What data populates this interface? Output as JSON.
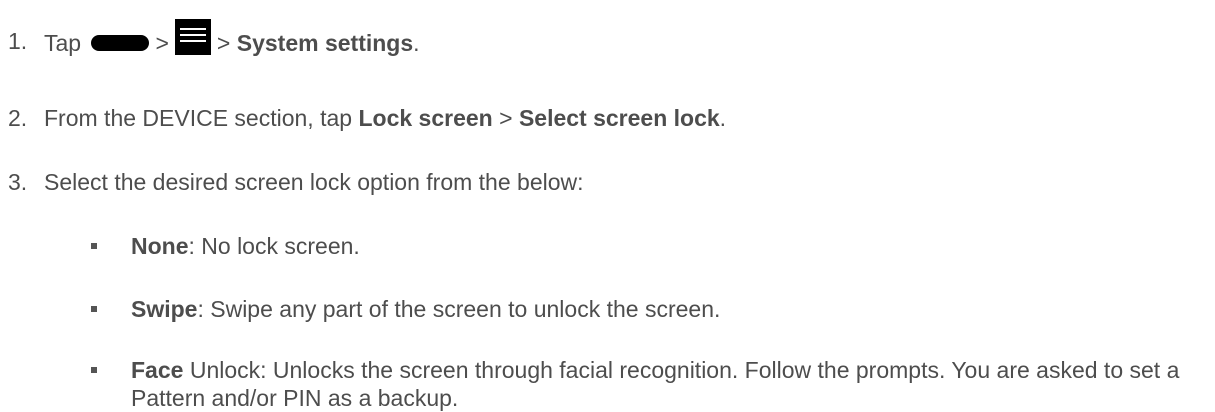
{
  "steps": [
    {
      "num": "1.",
      "tap": "Tap",
      "sep1": ">",
      "sep2": ">",
      "target": "System settings",
      "end": ".",
      "icons": [
        "home-key-icon",
        "menu-key-icon"
      ]
    },
    {
      "num": "2.",
      "prefix": "From the DEVICE section, tap",
      "bold1": "Lock screen",
      "sep": ">",
      "bold2": "Select screen lock",
      "end": "."
    },
    {
      "num": "3.",
      "text": "Select the desired screen lock option from the below:"
    }
  ],
  "options": [
    {
      "bold": "None",
      "text": ": No lock screen."
    },
    {
      "bold": "Swipe",
      "text": ": Swipe any part of the screen to unlock the screen."
    },
    {
      "bold": "Face",
      "text": " Unlock: Unlocks the screen through facial recognition. Follow the prompts. You are asked to set a Pattern and/or PIN as a backup."
    }
  ]
}
